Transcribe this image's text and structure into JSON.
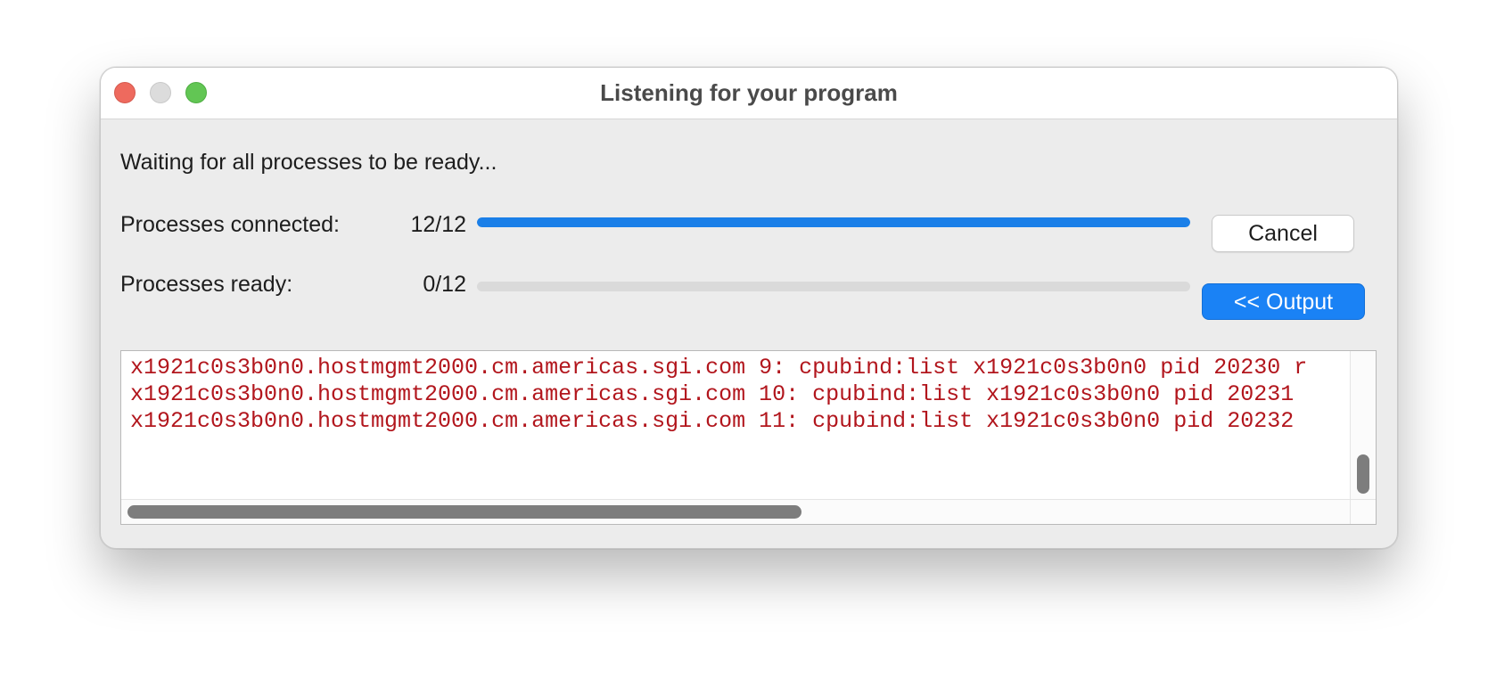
{
  "window": {
    "title": "Listening for your program"
  },
  "status_text": "Waiting for all processes to be ready...",
  "progress": [
    {
      "label": "Processes connected:",
      "count": "12/12",
      "fraction": 1.0,
      "fill_color": "#1a7fe8"
    },
    {
      "label": "Processes ready:",
      "count": "0/12",
      "fraction": 0.0,
      "fill_color": "#1a7fe8"
    }
  ],
  "buttons": {
    "cancel": "Cancel",
    "output": "<< Output"
  },
  "console": {
    "text_color": "#b2161d",
    "lines": [
      "x1921c0s3b0n0.hostmgmt2000.cm.americas.sgi.com 9: cpubind:list x1921c0s3b0n0 pid 20230 r",
      "x1921c0s3b0n0.hostmgmt2000.cm.americas.sgi.com 10: cpubind:list x1921c0s3b0n0 pid 20231",
      "x1921c0s3b0n0.hostmgmt2000.cm.americas.sgi.com 11: cpubind:list x1921c0s3b0n0 pid 20232"
    ]
  },
  "icons": {
    "close": "close-window-icon",
    "minimize": "minimize-window-icon",
    "zoom": "zoom-window-icon"
  }
}
